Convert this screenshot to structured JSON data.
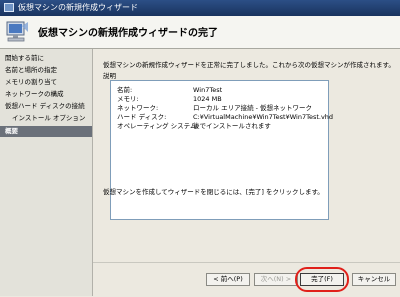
{
  "window": {
    "title": "仮想マシンの新規作成ウィザード"
  },
  "header": {
    "heading": "仮想マシンの新規作成ウィザードの完了"
  },
  "sidebar": {
    "items": [
      {
        "label": "開始する前に"
      },
      {
        "label": "名前と場所の指定"
      },
      {
        "label": "メモリの割り当て"
      },
      {
        "label": "ネットワークの構成"
      },
      {
        "label": "仮想ハード ディスクの接続"
      },
      {
        "label": "インストール オプション"
      },
      {
        "label": "概要"
      }
    ]
  },
  "main": {
    "intro": "仮想マシンの新規作成ウィザードを正常に完了しました。これから次の仮想マシンが作成されます。",
    "description_label": "説明",
    "summary": [
      {
        "key": "名前:",
        "value": "Win7Test"
      },
      {
        "key": "メモリ:",
        "value": "1024 MB"
      },
      {
        "key": "ネットワーク:",
        "value": "ローカル エリア接続 - 仮想ネットワーク"
      },
      {
        "key": "ハード ディスク:",
        "value": "C:¥VirtualMachine¥Win7Test¥Win7Test.vhd"
      },
      {
        "key": "オペレーティング システム:",
        "value": "後でインストールされます"
      }
    ],
    "footer_note": "仮想マシンを作成してウィザードを閉じるには、[完了] をクリックします。"
  },
  "buttons": {
    "prev": "< 前へ(P)",
    "next": "次へ(N) >",
    "finish": "完了(F)",
    "cancel": "キャンセル"
  },
  "colors": {
    "titlebar": "#1f3f73",
    "sidebar_active": "#6b717a",
    "highlight": "#e0201a"
  },
  "icons": {
    "titlebar": "virtual-machine-icon",
    "header": "wizard-computer-icon"
  }
}
